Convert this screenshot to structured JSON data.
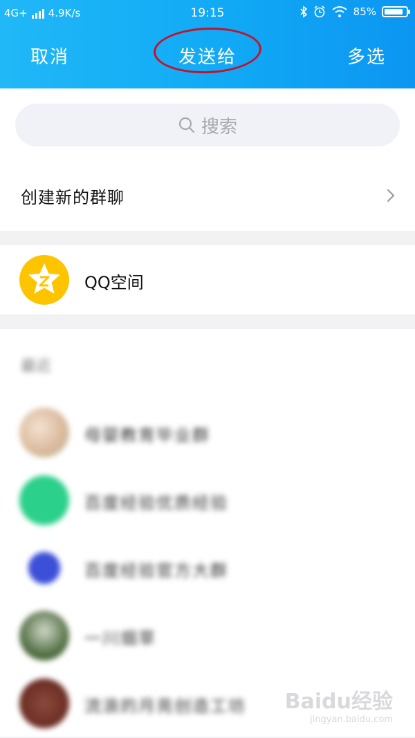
{
  "status_bar": {
    "network": "4G+",
    "speed": "4.9K/s",
    "time": "19:15",
    "battery": "85%",
    "battery_level": 0.85
  },
  "nav": {
    "cancel": "取消",
    "title": "发送给",
    "multi_select": "多选"
  },
  "search": {
    "placeholder": "搜索"
  },
  "create_group": {
    "label": "创建新的群聊"
  },
  "qzone": {
    "label": "QQ空间",
    "logo_color": "#ffc400"
  },
  "recent": {
    "heading": "最近",
    "items": [
      {
        "name": "母婴教育毕业群",
        "avatar_color": "#d9b79a"
      },
      {
        "name": "百度经验优质经验",
        "avatar_color": "#2bd08a"
      },
      {
        "name": "百度经验官方大群",
        "avatar_color": "#3b4fd8"
      },
      {
        "name": "一川烟草",
        "avatar_color": "#4d6b3d"
      },
      {
        "name": "流浪的月亮创造工坊",
        "avatar_color": "#6a2b22"
      }
    ]
  },
  "watermark": {
    "brand": "Baidu经验",
    "url": "jingyan.baidu.com"
  },
  "colors": {
    "accent": "#11a9f5",
    "annotation": "#c4122b"
  }
}
